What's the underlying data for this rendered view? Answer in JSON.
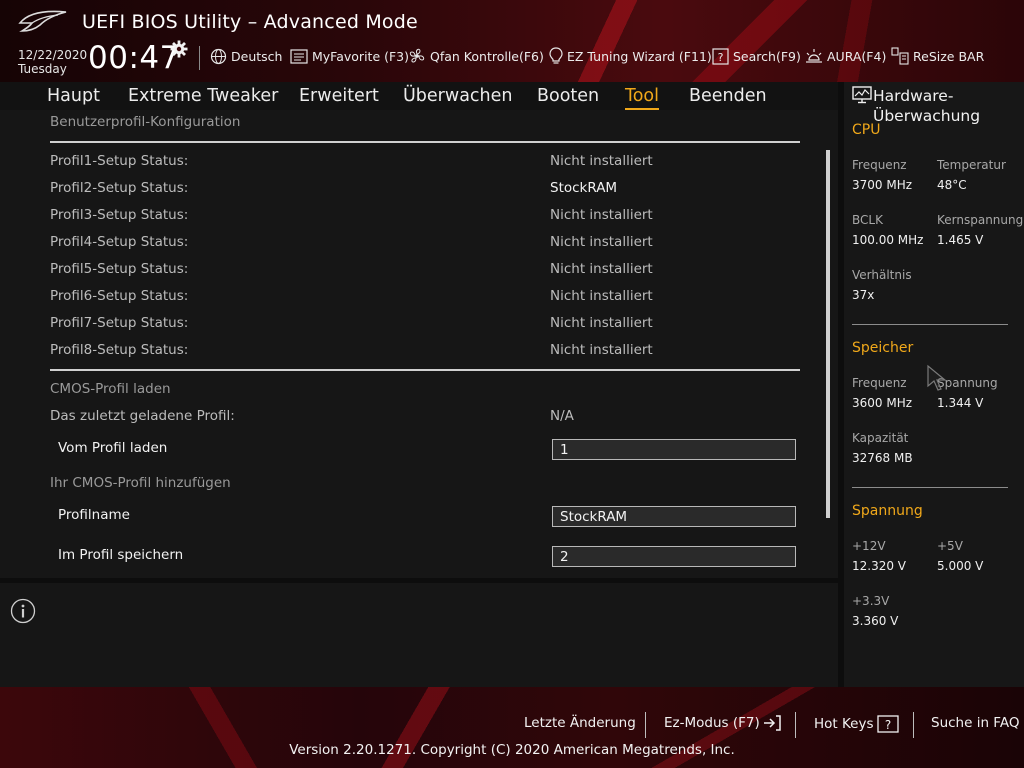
{
  "header": {
    "title": "UEFI BIOS Utility – Advanced Mode",
    "date": "12/22/2020",
    "day": "Tuesday",
    "time": "00:47",
    "toolbar": [
      {
        "label": "Deutsch",
        "icon": "globe-icon"
      },
      {
        "label": "MyFavorite (F3)",
        "icon": "favorite-list-icon"
      },
      {
        "label": "Qfan Kontrolle(F6)",
        "icon": "fan-icon"
      },
      {
        "label": "EZ Tuning Wizard (F11)",
        "icon": "lightbulb-icon"
      },
      {
        "label": "Search(F9)",
        "icon": "help-box-icon"
      },
      {
        "label": "AURA(F4)",
        "icon": "aura-light-icon"
      },
      {
        "label": "ReSize BAR",
        "icon": "resize-bar-icon"
      }
    ]
  },
  "menu": {
    "tabs": [
      "Haupt",
      "Extreme Tweaker",
      "Erweitert",
      "Überwachen",
      "Booten",
      "Tool",
      "Beenden"
    ],
    "active": "Tool"
  },
  "main": {
    "section1": "Benutzerprofil-Konfiguration",
    "profiles": [
      {
        "label": "Profil1-Setup Status:",
        "value": "Nicht installiert"
      },
      {
        "label": "Profil2-Setup Status:",
        "value": "StockRAM"
      },
      {
        "label": "Profil3-Setup Status:",
        "value": "Nicht installiert"
      },
      {
        "label": "Profil4-Setup Status:",
        "value": "Nicht installiert"
      },
      {
        "label": "Profil5-Setup Status:",
        "value": "Nicht installiert"
      },
      {
        "label": "Profil6-Setup Status:",
        "value": "Nicht installiert"
      },
      {
        "label": "Profil7-Setup Status:",
        "value": "Nicht installiert"
      },
      {
        "label": "Profil8-Setup Status:",
        "value": "Nicht installiert"
      }
    ],
    "section2": "CMOS-Profil laden",
    "last_loaded_label": "Das zuletzt geladene Profil:",
    "last_loaded_value": "N/A",
    "load_label": "Vom Profil laden",
    "load_value": "1",
    "section3": "Ihr CMOS-Profil hinzufügen",
    "name_label": "Profilname",
    "name_value": "StockRAM",
    "save_label": "Im Profil speichern",
    "save_value": "2"
  },
  "hw": {
    "title": "Hardware-Überwachung",
    "cpu": {
      "title": "CPU",
      "freq_label": "Frequenz",
      "freq": "3700 MHz",
      "temp_label": "Temperatur",
      "temp": "48°C",
      "bclk_label": "BCLK",
      "bclk": "100.00 MHz",
      "vcore_label": "Kernspannung",
      "vcore": "1.465 V",
      "ratio_label": "Verhältnis",
      "ratio": "37x"
    },
    "memory": {
      "title": "Speicher",
      "freq_label": "Frequenz",
      "freq": "3600 MHz",
      "volt_label": "Spannung",
      "volt": "1.344 V",
      "cap_label": "Kapazität",
      "cap": "32768 MB"
    },
    "voltage": {
      "title": "Spannung",
      "v12_label": "+12V",
      "v12": "12.320 V",
      "v5_label": "+5V",
      "v5": "5.000 V",
      "v33_label": "+3.3V",
      "v33": "3.360 V"
    }
  },
  "footer": {
    "last_change": "Letzte Änderung",
    "ez_mode": "Ez-Modus (F7)",
    "hotkeys": "Hot Keys",
    "faq": "Suche in FAQ",
    "copyright": "Version 2.20.1271. Copyright (C) 2020 American Megatrends, Inc."
  },
  "colors": {
    "accent": "#f0a81a",
    "brand_red": "#c8141e",
    "panel": "#161616"
  }
}
